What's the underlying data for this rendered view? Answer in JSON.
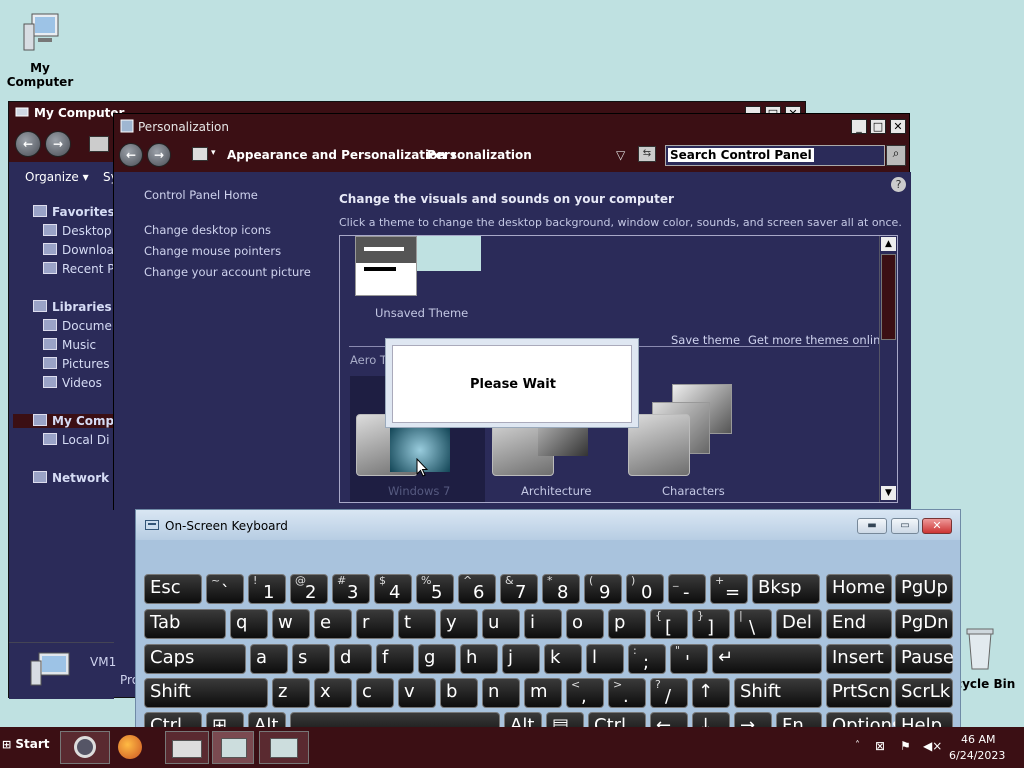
{
  "desktop": {
    "my_computer_label": "My Computer",
    "recycle_bin_label": "cycle Bin"
  },
  "explorer": {
    "title": "My Computer",
    "organize_label": "Organize",
    "system_label": "Sy",
    "sidebar": [
      {
        "label": "Favorites",
        "icon": "star-icon"
      },
      {
        "label": "Desktop",
        "icon": "desktop-icon"
      },
      {
        "label": "Downloa",
        "icon": "downloads-icon"
      },
      {
        "label": "Recent P",
        "icon": "recent-places-icon"
      },
      {
        "label": "Libraries",
        "icon": "libraries-icon"
      },
      {
        "label": "Documen",
        "icon": "documents-icon"
      },
      {
        "label": "Music",
        "icon": "music-icon"
      },
      {
        "label": "Pictures",
        "icon": "pictures-icon"
      },
      {
        "label": "Videos",
        "icon": "videos-icon"
      },
      {
        "label": "My Compu",
        "icon": "computer-icon"
      },
      {
        "label": "Local Di",
        "icon": "local-disk-icon"
      },
      {
        "label": "Network",
        "icon": "network-icon"
      }
    ],
    "status_name": "VM1",
    "status_sub": "Pro"
  },
  "personalization": {
    "title": "Personalization",
    "breadcrumb_1": "Appearance and Personalization",
    "breadcrumb_2": "Personalization",
    "search_placeholder": "Search Control Panel",
    "left_links": {
      "home": "Control Panel Home",
      "desktop_icons": "Change desktop icons",
      "mouse_pointers": "Change mouse pointers",
      "account_picture": "Change your account picture"
    },
    "heading": "Change the visuals and sounds on your computer",
    "subheading": "Click a theme to change the desktop background, window color, sounds, and screen saver all at once.",
    "unsaved_theme": "Unsaved Theme",
    "save_theme": "Save theme",
    "get_more_themes": "Get more themes online",
    "aero_label": "Aero T",
    "themes": [
      "Windows 7",
      "Architecture",
      "Characters"
    ],
    "dialog_text": "Please Wait"
  },
  "osk": {
    "title": "On-Screen Keyboard",
    "rows": [
      [
        {
          "k": "Esc"
        },
        {
          "sh": "~",
          "lo": "`"
        },
        {
          "sh": "!",
          "lo": "1"
        },
        {
          "sh": "@",
          "lo": "2"
        },
        {
          "sh": "#",
          "lo": "3"
        },
        {
          "sh": "$",
          "lo": "4"
        },
        {
          "sh": "%",
          "lo": "5"
        },
        {
          "sh": "^",
          "lo": "6"
        },
        {
          "sh": "&",
          "lo": "7"
        },
        {
          "sh": "*",
          "lo": "8"
        },
        {
          "sh": "(",
          "lo": "9"
        },
        {
          "sh": ")",
          "lo": "0"
        },
        {
          "sh": "_",
          "lo": "-"
        },
        {
          "sh": "+",
          "lo": "="
        },
        {
          "k": "Bksp"
        },
        {
          "k": "Home"
        },
        {
          "k": "PgUp"
        }
      ],
      [
        {
          "k": "Tab"
        },
        {
          "k": "q"
        },
        {
          "k": "w"
        },
        {
          "k": "e"
        },
        {
          "k": "r"
        },
        {
          "k": "t"
        },
        {
          "k": "y"
        },
        {
          "k": "u"
        },
        {
          "k": "i"
        },
        {
          "k": "o"
        },
        {
          "k": "p"
        },
        {
          "sh": "{",
          "lo": "["
        },
        {
          "sh": "}",
          "lo": "]"
        },
        {
          "sh": "|",
          "lo": "\\"
        },
        {
          "k": "Del"
        },
        {
          "k": "End"
        },
        {
          "k": "PgDn"
        }
      ],
      [
        {
          "k": "Caps"
        },
        {
          "k": "a"
        },
        {
          "k": "s"
        },
        {
          "k": "d"
        },
        {
          "k": "f"
        },
        {
          "k": "g"
        },
        {
          "k": "h"
        },
        {
          "k": "j"
        },
        {
          "k": "k"
        },
        {
          "k": "l"
        },
        {
          "sh": ":",
          "lo": ";"
        },
        {
          "sh": "\"",
          "lo": "'"
        },
        {
          "k": "↵"
        },
        {
          "k": "Insert"
        },
        {
          "k": "Pause"
        }
      ],
      [
        {
          "k": "Shift"
        },
        {
          "k": "z"
        },
        {
          "k": "x"
        },
        {
          "k": "c"
        },
        {
          "k": "v"
        },
        {
          "k": "b"
        },
        {
          "k": "n"
        },
        {
          "k": "m"
        },
        {
          "sh": "<",
          "lo": ","
        },
        {
          "sh": ">",
          "lo": "."
        },
        {
          "sh": "?",
          "lo": "/"
        },
        {
          "k": "↑"
        },
        {
          "k": "Shift"
        },
        {
          "k": "PrtScn"
        },
        {
          "k": "ScrLk"
        }
      ],
      [
        {
          "k": "Ctrl"
        },
        {
          "k": "⊞"
        },
        {
          "k": "Alt"
        },
        {
          "k": ""
        },
        {
          "k": "Alt"
        },
        {
          "k": "▤"
        },
        {
          "k": "Ctrl"
        },
        {
          "k": "←"
        },
        {
          "k": "↓"
        },
        {
          "k": "→"
        },
        {
          "k": "Fn"
        },
        {
          "k": "Options"
        },
        {
          "k": "Help"
        }
      ]
    ]
  },
  "taskbar": {
    "start_label": "Start",
    "time": "46 AM",
    "date": "6/24/2023"
  }
}
